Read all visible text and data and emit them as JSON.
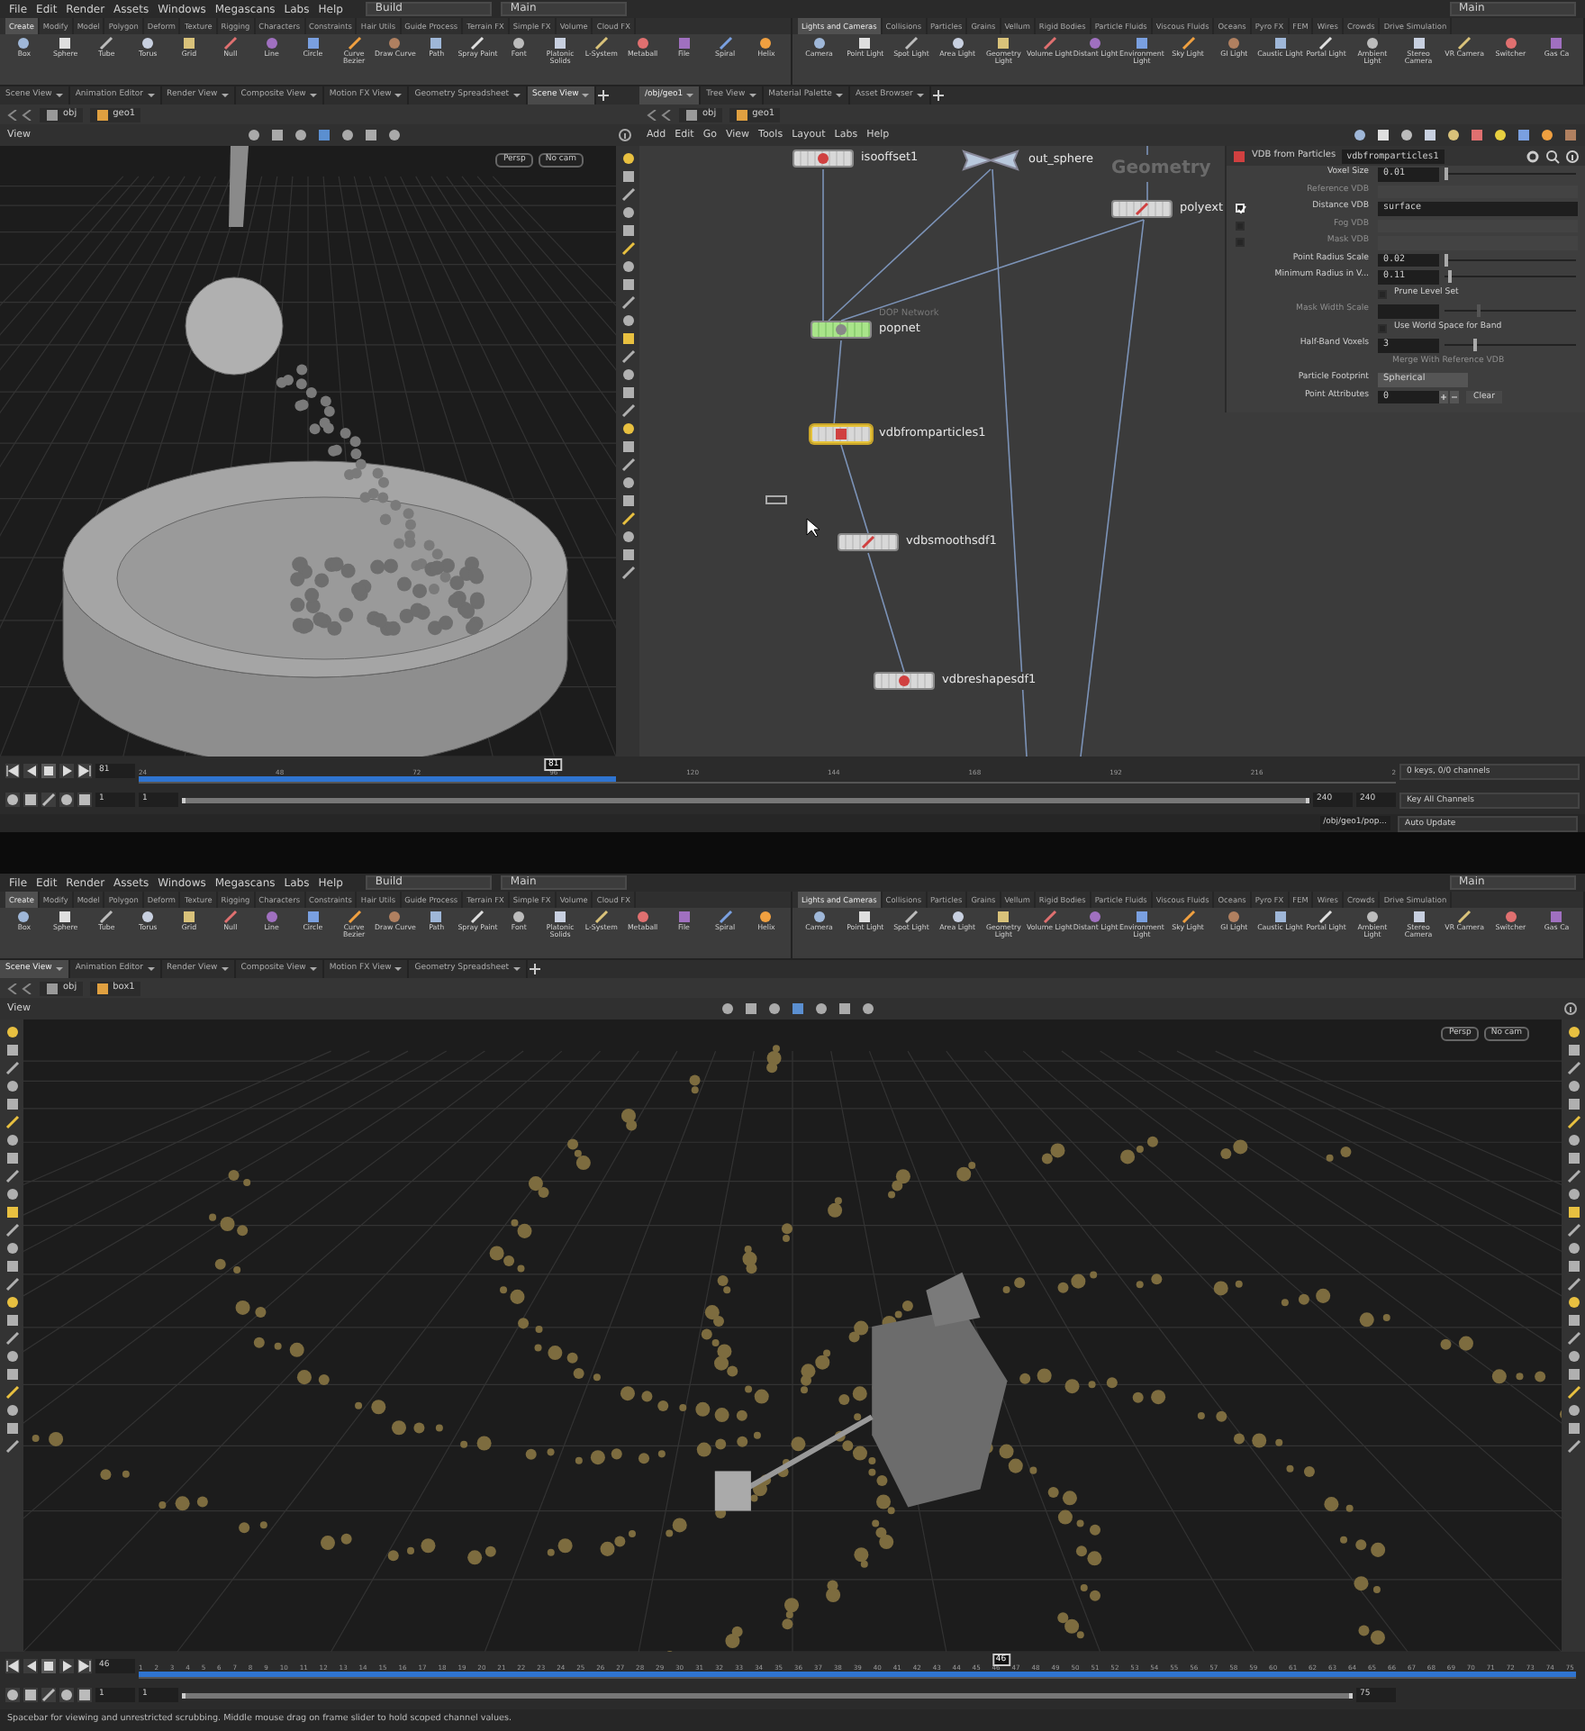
{
  "screens": [
    {
      "menu": [
        "File",
        "Edit",
        "Render",
        "Assets",
        "Windows",
        "Megascans",
        "Labs",
        "Help"
      ],
      "desktop": "Build",
      "workspace": "Main",
      "workspace_right": "Main",
      "shelf_left": {
        "tabs": [
          {
            "label": "Create",
            "selected": true
          },
          {
            "label": "Modify",
            "selected": false
          },
          {
            "label": "Model",
            "selected": false
          },
          {
            "label": "Polygon",
            "selected": false
          },
          {
            "label": "Deform",
            "selected": false
          },
          {
            "label": "Texture",
            "selected": false
          },
          {
            "label": "Rigging",
            "selected": false
          },
          {
            "label": "Characters",
            "selected": false
          },
          {
            "label": "Constraints",
            "selected": false
          },
          {
            "label": "Hair Utils",
            "selected": false
          },
          {
            "label": "Guide Process",
            "selected": false
          },
          {
            "label": "Terrain FX",
            "selected": false
          },
          {
            "label": "Simple FX",
            "selected": false
          },
          {
            "label": "Volume",
            "selected": false
          },
          {
            "label": "Cloud FX",
            "selected": false
          }
        ],
        "tools": [
          "Box",
          "Sphere",
          "Tube",
          "Torus",
          "Grid",
          "Null",
          "Line",
          "Circle",
          "Curve Bezier",
          "Draw Curve",
          "Path",
          "Spray Paint",
          "Font",
          "Platonic Solids",
          "L-System",
          "Metaball",
          "File",
          "Spiral",
          "Helix"
        ]
      },
      "shelf_right": {
        "tabs": [
          {
            "label": "Lights and Cameras",
            "selected": true
          },
          {
            "label": "Collisions",
            "selected": false
          },
          {
            "label": "Particles",
            "selected": false
          },
          {
            "label": "Grains",
            "selected": false
          },
          {
            "label": "Vellum",
            "selected": false
          },
          {
            "label": "Rigid Bodies",
            "selected": false
          },
          {
            "label": "Particle Fluids",
            "selected": false
          },
          {
            "label": "Viscous Fluids",
            "selected": false
          },
          {
            "label": "Oceans",
            "selected": false
          },
          {
            "label": "Pyro FX",
            "selected": false
          },
          {
            "label": "FEM",
            "selected": false
          },
          {
            "label": "Wires",
            "selected": false
          },
          {
            "label": "Crowds",
            "selected": false
          },
          {
            "label": "Drive Simulation",
            "selected": false
          }
        ],
        "tools": [
          "Camera",
          "Point Light",
          "Spot Light",
          "Area Light",
          "Geometry Light",
          "Volume Light",
          "Distant Light",
          "Environment Light",
          "Sky Light",
          "GI Light",
          "Caustic Light",
          "Portal Light",
          "Ambient Light",
          "Stereo Camera",
          "VR Camera",
          "Switcher",
          "Gas Ca"
        ]
      },
      "pane_tabs": [
        {
          "label": "Scene View",
          "selected": false
        },
        {
          "label": "Animation Editor",
          "selected": false
        },
        {
          "label": "Render View",
          "selected": false
        },
        {
          "label": "Composite View",
          "selected": false
        },
        {
          "label": "Motion FX View",
          "selected": false
        },
        {
          "label": "Geometry Spreadsheet",
          "selected": false
        },
        {
          "label": "Scene View",
          "selected": true
        }
      ],
      "path": [
        "obj",
        "geo1"
      ],
      "viewport": {
        "title": "View",
        "kind": "mesh",
        "camera": "Persp",
        "lens": "No cam"
      },
      "network": {
        "tabs": [
          {
            "label": "/obj/geo1",
            "selected": true
          },
          {
            "label": "Tree View",
            "selected": false
          },
          {
            "label": "Material Palette",
            "selected": false
          },
          {
            "label": "Asset Browser",
            "selected": false
          }
        ],
        "path": [
          "obj",
          "geo1"
        ],
        "menu": [
          "Add",
          "Edit",
          "Go",
          "View",
          "Tools",
          "Layout",
          "Labs",
          "Help"
        ],
        "context_label": "Geometry",
        "nodes": [
          {
            "name": "isooffset1",
            "kind": "sop",
            "selected": false
          },
          {
            "name": "out_sphere",
            "kind": "null",
            "selected": false
          },
          {
            "name": "polyext",
            "kind": "sop",
            "selected": false
          },
          {
            "name": "popnet",
            "kind": "dop",
            "selected": false,
            "comment": "DOP Network"
          },
          {
            "name": "vdbfromparticles1",
            "kind": "sop",
            "selected": true
          },
          {
            "name": "vdbsmoothsdf1",
            "kind": "sop",
            "selected": false
          },
          {
            "name": "vdbreshapesdf1",
            "kind": "sop",
            "selected": false
          }
        ],
        "params": {
          "type": "VDB from Particles",
          "name": "vdbfromparticles1",
          "rows": [
            {
              "kind": "number",
              "label": "Voxel Size",
              "value": "0.01",
              "level": 0.0,
              "disabled": false
            },
            {
              "kind": "field",
              "label": "Reference VDB",
              "disabled": true
            },
            {
              "kind": "field",
              "label": "Distance VDB",
              "value": "surface",
              "toggle": true,
              "disabled": false
            },
            {
              "kind": "field",
              "label": "Fog VDB",
              "toggle": false,
              "disabled": true
            },
            {
              "kind": "field",
              "label": "Mask VDB",
              "toggle": false,
              "disabled": true
            },
            {
              "kind": "number",
              "label": "Point Radius Scale",
              "value": "0.02",
              "level": 0.0,
              "disabled": false
            },
            {
              "kind": "number",
              "label": "Minimum Radius in V...",
              "value": "0.11",
              "level": 0.03,
              "disabled": false
            },
            {
              "kind": "check",
              "label": "Prune Level Set",
              "checked": false,
              "disabled": false
            },
            {
              "kind": "number",
              "label": "Mask Width Scale",
              "level": 0.25,
              "disabled": true
            },
            {
              "kind": "check",
              "label": "Use World Space for Band",
              "checked": false,
              "disabled": false
            },
            {
              "kind": "number",
              "label": "Half-Band Voxels",
              "value": "3",
              "level": 0.22,
              "disabled": false
            },
            {
              "kind": "note",
              "label": "Merge With Reference VDB",
              "disabled": true
            },
            {
              "kind": "menu",
              "label": "Particle Footprint",
              "value": "Spherical",
              "disabled": false
            },
            {
              "kind": "multi",
              "label": "Point Attributes",
              "value": "0",
              "button": "Clear",
              "disabled": false
            }
          ]
        }
      },
      "timeline": {
        "frame": "81",
        "playhead": "81",
        "level": 0.33,
        "cache_bar": {
          "level": 0.38
        },
        "range_slider": {
          "level": 1.0
        },
        "ticks": [
          "24",
          "48",
          "72",
          "96",
          "120",
          "144",
          "168",
          "192",
          "216",
          "2"
        ],
        "start": "1",
        "range_start": "1",
        "range_end": "240",
        "end": "240",
        "keys": "0 keys, 0/0 channels",
        "key_button": "Key All Channels"
      },
      "footer": {
        "path": "/obj/geo1/pop...",
        "update": "Auto Update"
      }
    },
    {
      "menu": [
        "File",
        "Edit",
        "Render",
        "Assets",
        "Windows",
        "Megascans",
        "Labs",
        "Help"
      ],
      "desktop": "Build",
      "workspace": "Main",
      "workspace_right": "Main",
      "shelf_left": {
        "tabs": [
          {
            "label": "Create",
            "selected": true
          },
          {
            "label": "Modify",
            "selected": false
          },
          {
            "label": "Model",
            "selected": false
          },
          {
            "label": "Polygon",
            "selected": false
          },
          {
            "label": "Deform",
            "selected": false
          },
          {
            "label": "Texture",
            "selected": false
          },
          {
            "label": "Rigging",
            "selected": false
          },
          {
            "label": "Characters",
            "selected": false
          },
          {
            "label": "Constraints",
            "selected": false
          },
          {
            "label": "Hair Utils",
            "selected": false
          },
          {
            "label": "Guide Process",
            "selected": false
          },
          {
            "label": "Terrain FX",
            "selected": false
          },
          {
            "label": "Simple FX",
            "selected": false
          },
          {
            "label": "Volume",
            "selected": false
          },
          {
            "label": "Cloud FX",
            "selected": false
          }
        ],
        "tools": [
          "Box",
          "Sphere",
          "Tube",
          "Torus",
          "Grid",
          "Null",
          "Line",
          "Circle",
          "Curve Bezier",
          "Draw Curve",
          "Path",
          "Spray Paint",
          "Font",
          "Platonic Solids",
          "L-System",
          "Metaball",
          "File",
          "Spiral",
          "Helix"
        ]
      },
      "shelf_right": {
        "tabs": [
          {
            "label": "Lights and Cameras",
            "selected": true
          },
          {
            "label": "Collisions",
            "selected": false
          },
          {
            "label": "Particles",
            "selected": false
          },
          {
            "label": "Grains",
            "selected": false
          },
          {
            "label": "Vellum",
            "selected": false
          },
          {
            "label": "Rigid Bodies",
            "selected": false
          },
          {
            "label": "Particle Fluids",
            "selected": false
          },
          {
            "label": "Viscous Fluids",
            "selected": false
          },
          {
            "label": "Oceans",
            "selected": false
          },
          {
            "label": "Pyro FX",
            "selected": false
          },
          {
            "label": "FEM",
            "selected": false
          },
          {
            "label": "Wires",
            "selected": false
          },
          {
            "label": "Crowds",
            "selected": false
          },
          {
            "label": "Drive Simulation",
            "selected": false
          }
        ],
        "tools": [
          "Camera",
          "Point Light",
          "Spot Light",
          "Area Light",
          "Geometry Light",
          "Volume Light",
          "Distant Light",
          "Environment Light",
          "Sky Light",
          "GI Light",
          "Caustic Light",
          "Portal Light",
          "Ambient Light",
          "Stereo Camera",
          "VR Camera",
          "Switcher",
          "Gas Ca"
        ]
      },
      "pane_tabs": [
        {
          "label": "Scene View",
          "selected": true
        },
        {
          "label": "Animation Editor",
          "selected": false
        },
        {
          "label": "Render View",
          "selected": false
        },
        {
          "label": "Composite View",
          "selected": false
        },
        {
          "label": "Motion FX View",
          "selected": false
        },
        {
          "label": "Geometry Spreadsheet",
          "selected": false
        }
      ],
      "path": [
        "obj",
        "box1"
      ],
      "viewport": {
        "title": "View",
        "kind": "particles",
        "camera": "Persp",
        "lens": "No cam"
      },
      "timeline": {
        "frame": "46",
        "playhead": "46",
        "level": 0.6,
        "cache_bar": {
          "level": 1.0
        },
        "range_slider": {
          "level": 1.0
        },
        "ticks": [
          "1",
          "2",
          "3",
          "4",
          "5",
          "6",
          "7",
          "8",
          "9",
          "10",
          "11",
          "12",
          "13",
          "14",
          "15",
          "16",
          "17",
          "18",
          "19",
          "20",
          "21",
          "22",
          "23",
          "24",
          "25",
          "26",
          "27",
          "28",
          "29",
          "30",
          "31",
          "32",
          "33",
          "34",
          "35",
          "36",
          "37",
          "38",
          "39",
          "40",
          "41",
          "42",
          "43",
          "44",
          "45",
          "46",
          "47",
          "48",
          "49",
          "50",
          "51",
          "52",
          "53",
          "54",
          "55",
          "56",
          "57",
          "58",
          "59",
          "60",
          "61",
          "62",
          "63",
          "64",
          "65",
          "66",
          "67",
          "68",
          "69",
          "70",
          "71",
          "72",
          "73",
          "74",
          "75"
        ],
        "start": "1",
        "range_start": "1",
        "end": "75"
      },
      "status": "Spacebar for viewing and unrestricted scrubbing. Middle mouse drag on frame slider to hold scoped channel values."
    }
  ]
}
